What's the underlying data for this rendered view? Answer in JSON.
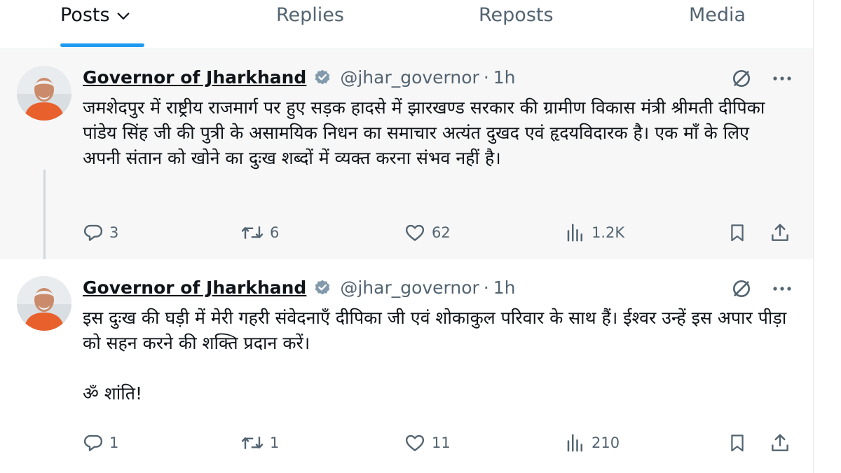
{
  "tabs": [
    {
      "label": "Posts",
      "active": true
    },
    {
      "label": "Replies",
      "active": false
    },
    {
      "label": "Reposts",
      "active": false
    },
    {
      "label": "Media",
      "active": false
    }
  ],
  "colors": {
    "accent": "#1d9bf0",
    "verified": "#829aab",
    "muted": "#536471",
    "text": "#0f1419"
  },
  "posts": [
    {
      "author_name": "Governor of Jharkhand",
      "handle": "@jhar_governor",
      "separator": "·",
      "time": "1h",
      "text": "जमशेदपुर में राष्ट्रीय राजमार्ग पर हुए सड़क हादसे में झारखण्ड सरकार की ग्रामीण विकास मंत्री श्रीमती दीपिका पांडेय सिंह जी की पुत्री के असामयिक निधन का समाचार अत्यंत दुखद एवं हृदयविदारक है। एक माँ के लिए अपनी संतान को खोने का दुःख शब्दों में व्यक्त करना संभव नहीं है।",
      "replies": "3",
      "reposts": "6",
      "likes": "62",
      "views": "1.2K"
    },
    {
      "author_name": "Governor of Jharkhand",
      "handle": "@jhar_governor",
      "separator": "·",
      "time": "1h",
      "text": "इस दुःख की घड़ी में मेरी गहरी संवेदनाएँ दीपिका जी एवं शोकाकुल परिवार के साथ हैं। ईश्वर उन्हें इस अपार पीड़ा को सहन करने की शक्ति प्रदान करें।\n\nॐ शांति!",
      "replies": "1",
      "reposts": "1",
      "likes": "11",
      "views": "210"
    }
  ],
  "icons": [
    "chevron-down-icon",
    "verified-badge-icon",
    "grok-icon",
    "more-icon",
    "reply-icon",
    "repost-icon",
    "like-icon",
    "views-icon",
    "bookmark-icon",
    "share-icon"
  ]
}
